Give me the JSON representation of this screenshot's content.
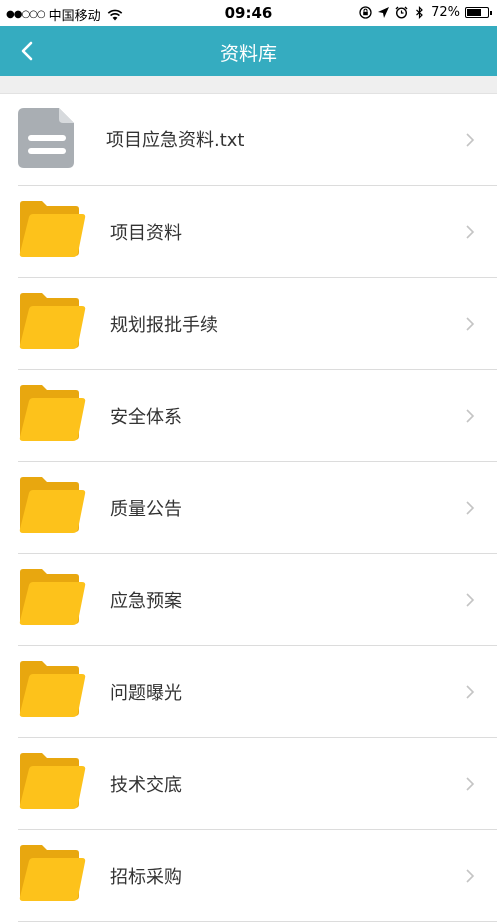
{
  "status_bar": {
    "signal": "●●○○○",
    "carrier": "中国移动",
    "time": "09:46",
    "battery_percent": "72%",
    "battery_level": 0.72
  },
  "nav": {
    "title": "资料库",
    "color": "#35acc0"
  },
  "items": [
    {
      "label": "项目应急资料.txt",
      "icon": "document-icon"
    },
    {
      "label": "项目资料",
      "icon": "folder-icon"
    },
    {
      "label": "规划报批手续",
      "icon": "folder-icon"
    },
    {
      "label": "安全体系",
      "icon": "folder-icon"
    },
    {
      "label": "质量公告",
      "icon": "folder-icon"
    },
    {
      "label": "应急预案",
      "icon": "folder-icon"
    },
    {
      "label": "问题曝光",
      "icon": "folder-icon"
    },
    {
      "label": "技术交底",
      "icon": "folder-icon"
    },
    {
      "label": "招标采购",
      "icon": "folder-icon"
    }
  ]
}
